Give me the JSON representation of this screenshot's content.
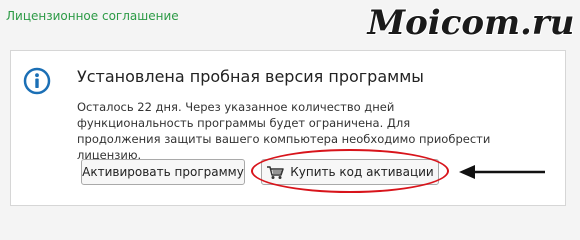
{
  "header": {
    "license_link": "Лицензионное соглашение",
    "brand": "Moicom.ru"
  },
  "panel": {
    "icon": "info-icon",
    "title": "Установлена пробная версия программы",
    "description": "Осталось 22 дня. Через указанное количество дней функциональность программы будет ограничена. Для продолжения защиты вашего компьютера необходимо приобрести лицензию.",
    "buttons": {
      "activate_label": "Активировать программу",
      "buy_label": "Купить код активации",
      "buy_icon": "cart-icon"
    },
    "annotation": {
      "highlight": "red-ellipse",
      "pointer": "arrow-left-icon"
    }
  },
  "colors": {
    "link": "#2c9a45",
    "info_icon": "#1b6fb5",
    "highlight": "#d8141b",
    "brand_text": "#1a1a1a"
  }
}
